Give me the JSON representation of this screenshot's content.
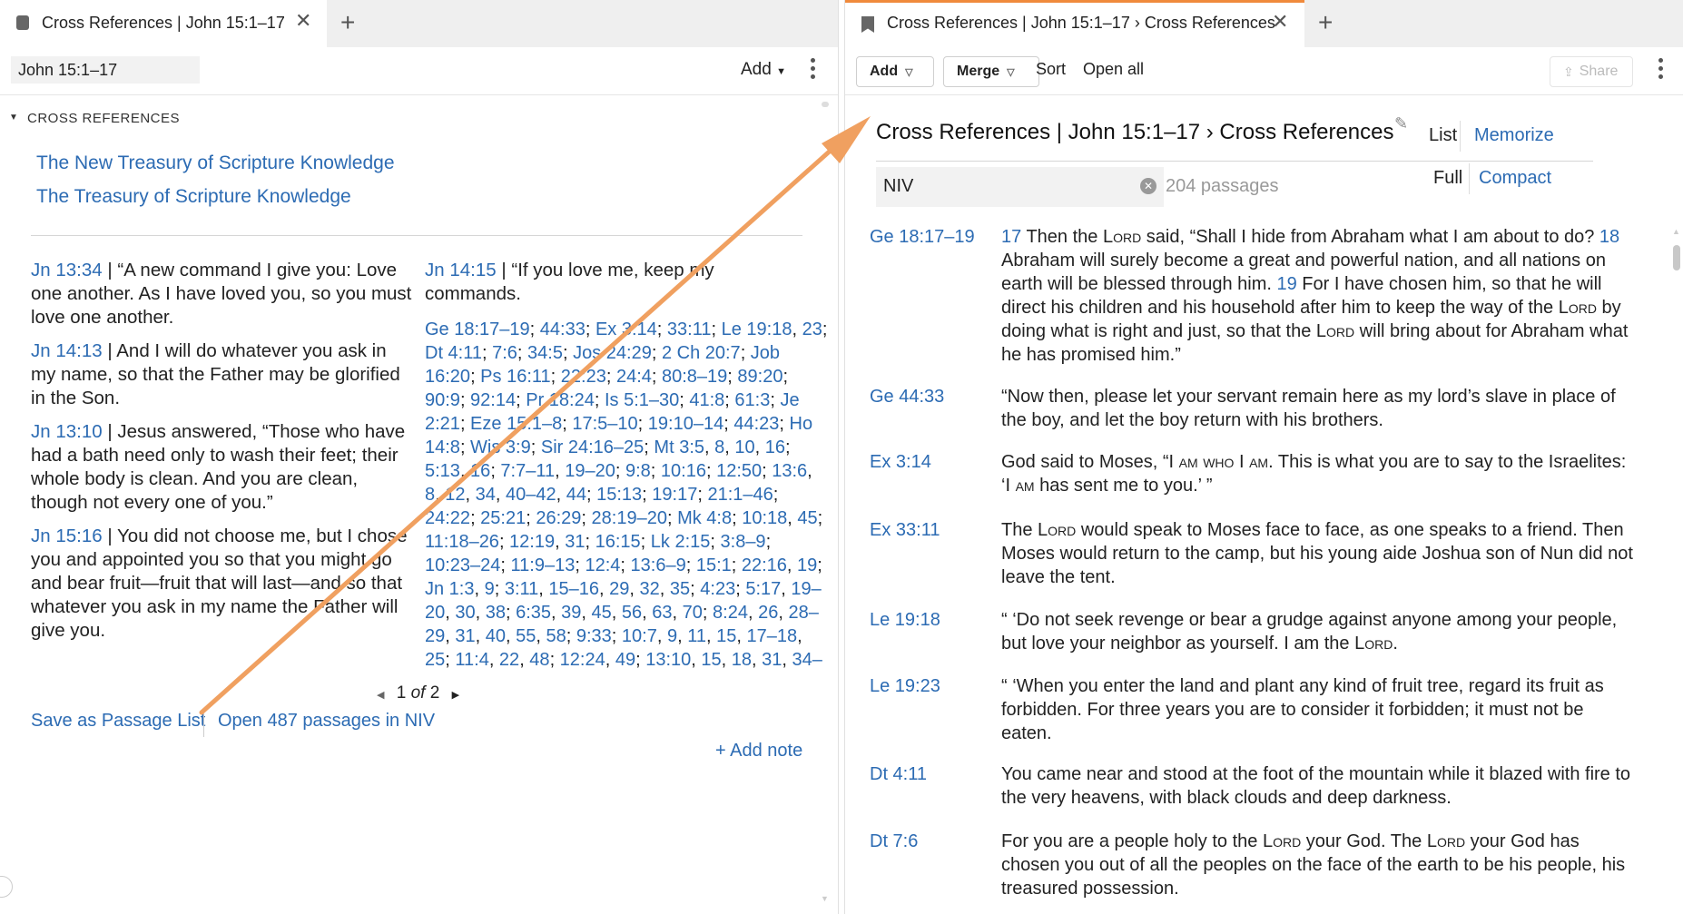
{
  "left": {
    "tab_title": "Cross References | John 15:1–17",
    "reference_input": "John 15:1–17",
    "add_label": "Add",
    "section_heading": "CROSS REFERENCES",
    "resources": [
      "The New Treasury of Scripture Knowledge",
      "The Treasury of Scripture Knowledge"
    ],
    "verses": [
      {
        "ref": "Jn 13:34",
        "text": " | “A new command I give you: Love one another. As I have loved you, so you must love one another."
      },
      {
        "ref": "Jn 14:13",
        "text": " | And I will do whatever you ask in my name, so that the Father may be glorified in the Son."
      },
      {
        "ref": "Jn 13:10",
        "text": " | Jesus answered, “Those who have had a bath need only to wash their feet; their whole body is clean. And you are clean, though not every one of you.”"
      },
      {
        "ref": "Jn 15:16",
        "text": " | You did not choose me, but I chose you and appointed you so that you might go and bear fruit—fruit that will last—and so that whatever you ask in my name the Father will give you."
      },
      {
        "ref": "Jn 14:15",
        "text": " | “If you love me, keep my commands."
      }
    ],
    "refs_lines": [
      "Ge 18:17–19; 44:33; Ex 3:14; 33:11; Le 19:18, 23;",
      "Dt 4:11; 7:6; 34:5; Jos 24:29; 2 Ch 20:7; Job",
      "16:20; Ps 16:11; 22:23; 24:4; 80:8–19; 89:20;",
      "90:9; 92:14; Pr 18:24; Is 5:1–30; 41:8; 61:3; Je",
      "2:21; Eze 15:1–8; 17:5–10; 19:10–14; 44:23; Ho",
      "14:8; Wis 3:9; Sir 24:16–25; Mt 3:5, 8, 10, 16;",
      "5:13, 16; 7:7–11, 19–20; 9:8; 10:16; 12:50; 13:6,",
      "8, 12, 34, 40–42, 44; 15:13; 19:17; 21:1–46;",
      "24:22; 25:21; 26:29; 28:19–20; Mk 4:8; 10:18, 45;",
      "11:18–26; 12:19, 31; 16:15; Lk 2:15; 3:8–9;",
      "10:23–24; 11:9–13; 12:4; 13:6–9; 15:1; 22:16, 19;",
      "Jn 1:3, 9; 3:11, 15–16, 29, 32, 35; 4:23; 5:17, 19–",
      "20, 30, 38; 6:35, 39, 45, 56, 63, 70; 8:24, 26, 28–",
      "29, 31, 40, 55, 58; 9:33; 10:7, 9, 11, 15, 17–18,",
      "25; 11:4, 22, 48; 12:24, 49; 13:10, 15, 18, 31, 34–"
    ],
    "pager": {
      "current": "1",
      "of_word": "of",
      "total": "2"
    },
    "save_link": "Save as Passage List",
    "open_link": "Open 487 passages in NIV",
    "add_note": "+ Add note"
  },
  "right": {
    "tab_title": "Cross References | John 15:1–17 › Cross References",
    "add_btn": "Add",
    "merge_btn": "Merge",
    "sort_btn": "Sort",
    "openall_btn": "Open all",
    "share_btn": "Share",
    "list_title": "Cross References | John 15:1–17 › Cross References",
    "view_list": "List",
    "view_memorize": "Memorize",
    "view_full": "Full",
    "view_compact": "Compact",
    "version": "NIV",
    "passage_count": "204 passages",
    "passages": [
      {
        "ref": "Ge 18:17–19",
        "html": "<span class=\"vnum\">17</span> Then the L<span class=\"sc\">ord</span> said, “Shall I hide from Abraham what I am about to do? <span class=\"vnum\">18</span> Abraham will surely become a great and powerful nation, and all nations on earth will be blessed through him. <span class=\"vnum\">19</span> For I have chosen him, so that he will direct his children and his household after him to keep the way of the L<span class=\"sc\">ord</span> by doing what is right and just, so that the L<span class=\"sc\">ord</span> will bring about for Abraham what he has promised him.”"
      },
      {
        "ref": "Ge 44:33",
        "html": "“Now then, please let your servant remain here as my lord’s slave in place of the boy, and let the boy return with his brothers."
      },
      {
        "ref": "Ex 3:14",
        "html": "God said to Moses, “I <span class=\"sc\">am who</span> I <span class=\"sc\">am</span>. This is what you are to say to the Israelites: ‘I <span class=\"sc\">am</span> has sent me to you.’ ”"
      },
      {
        "ref": "Ex 33:11",
        "html": "The L<span class=\"sc\">ord</span> would speak to Moses face to face, as one speaks to a friend. Then Moses would return to the camp, but his young aide Joshua son of Nun did not leave the tent."
      },
      {
        "ref": "Le 19:18",
        "html": "“ ‘Do not seek revenge or bear a grudge against anyone among your people, but love your neighbor as yourself. I am the L<span class=\"sc\">ord</span>."
      },
      {
        "ref": "Le 19:23",
        "html": "“ ‘When you enter the land and plant any kind of fruit tree, regard its fruit as forbidden. For three years you are to consider it forbidden; it must not be eaten."
      },
      {
        "ref": "Dt 4:11",
        "html": "You came near and stood at the foot of the mountain while it blazed with fire to the very heavens, with black clouds and deep darkness."
      },
      {
        "ref": "Dt 7:6",
        "html": "For you are a people holy to the L<span class=\"sc\">ord</span> your God. The L<span class=\"sc\">ord</span> your God has chosen you out of all the peoples on the face of the earth to be his people, his treasured possession."
      }
    ]
  },
  "colors": {
    "link": "#2c6bb3",
    "arrow": "#f0a060",
    "tab_accent": "#f08a3c"
  }
}
